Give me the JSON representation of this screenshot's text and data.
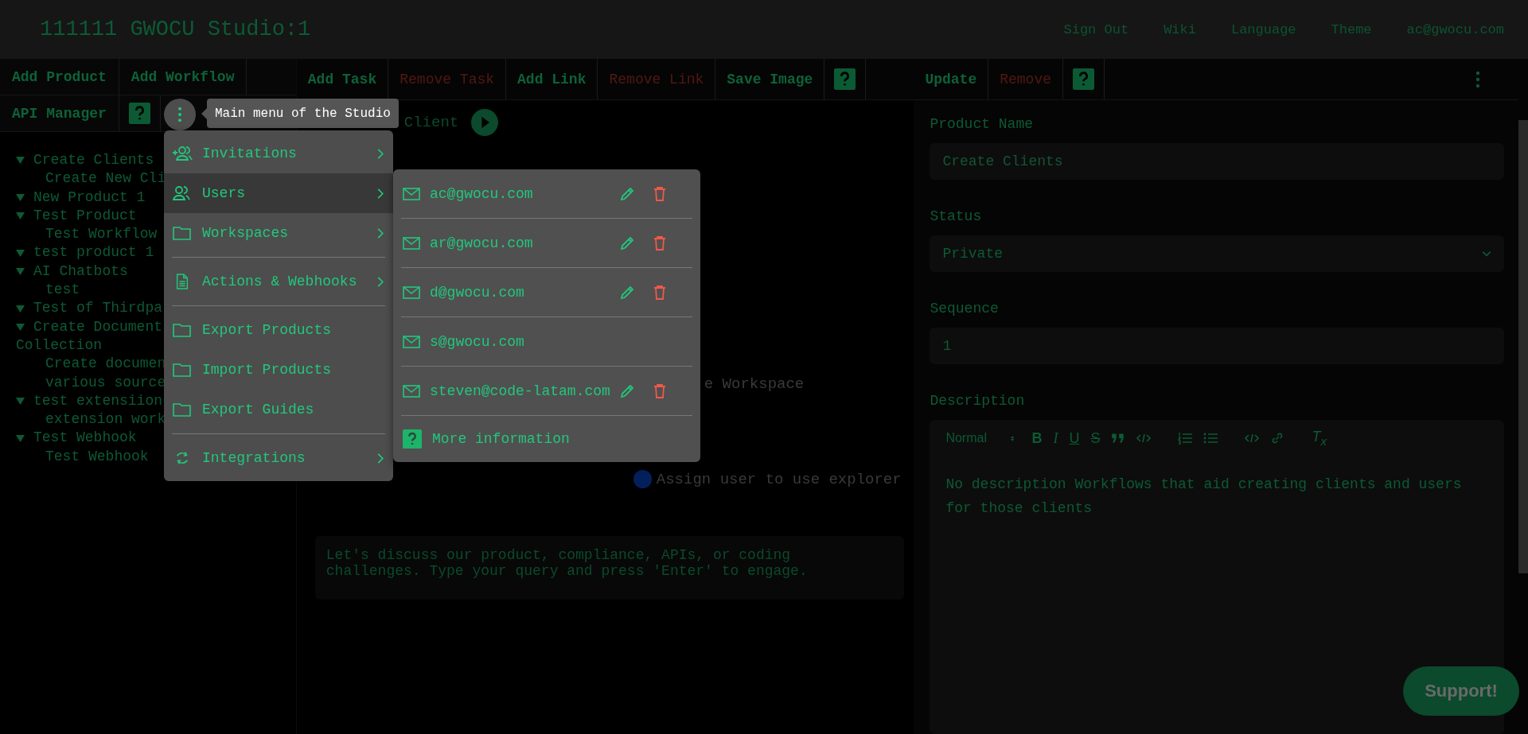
{
  "header": {
    "title": "111111 GWOCU Studio:1",
    "links": [
      "Sign Out",
      "Wiki",
      "Language",
      "Theme",
      "ac@gwocu.com"
    ]
  },
  "left_toolbar": {
    "rows": [
      [
        "Add Product",
        "Add Workflow"
      ],
      [
        "API Manager"
      ]
    ]
  },
  "tree": [
    {
      "label": "Create Clients",
      "children": [
        {
          "label": "Create New Cli"
        }
      ]
    },
    {
      "label": "New Product 1"
    },
    {
      "label": "Test Product",
      "children": [
        {
          "label": "Test Workflow"
        }
      ]
    },
    {
      "label": "test product 1"
    },
    {
      "label": "AI Chatbots",
      "children": [
        {
          "label": "test"
        }
      ]
    },
    {
      "label": "Test of Thirdpa"
    },
    {
      "label": "Create Document",
      "label_2": "Collection",
      "children": [
        {
          "label": "Create documen",
          "label_2": "various source"
        }
      ]
    },
    {
      "label": "test extensiion",
      "children": [
        {
          "label": "extension work"
        }
      ]
    },
    {
      "label": "Test Webhook",
      "children": [
        {
          "label": "Test Webhook"
        }
      ]
    }
  ],
  "middle_toolbar": [
    {
      "label": "Add Task",
      "kind": "normal"
    },
    {
      "label": "Remove Task",
      "kind": "danger"
    },
    {
      "label": "Add Link",
      "kind": "normal"
    },
    {
      "label": "Remove Link",
      "kind": "danger"
    },
    {
      "label": "Save Image",
      "kind": "normal"
    }
  ],
  "canvas": {
    "client_label": "Client",
    "workspace_label": "e Workspace",
    "assign_label": "Assign user to use explorer"
  },
  "chat": {
    "placeholder": "Let's discuss our product, compliance, APIs, or coding challenges. Type your query and press 'Enter' to engage."
  },
  "tooltip": "Main menu of the Studio",
  "main_menu": {
    "groups": [
      [
        {
          "label": "Invitations",
          "submenu": true,
          "selected": false
        },
        {
          "label": "Users",
          "submenu": true,
          "selected": true
        },
        {
          "label": "Workspaces",
          "submenu": true,
          "selected": false
        }
      ],
      [
        {
          "label": "Actions & Webhooks",
          "submenu": true,
          "selected": false
        }
      ],
      [
        {
          "label": "Export Products",
          "submenu": false,
          "selected": false
        },
        {
          "label": "Import Products",
          "submenu": false,
          "selected": false
        },
        {
          "label": "Export Guides",
          "submenu": false,
          "selected": false
        }
      ],
      [
        {
          "label": "Integrations",
          "submenu": true,
          "selected": false
        }
      ]
    ]
  },
  "users_menu": {
    "users": [
      {
        "email": "ac@gwocu.com",
        "actions": true
      },
      {
        "email": "ar@gwocu.com",
        "actions": true
      },
      {
        "email": "d@gwocu.com",
        "actions": true
      },
      {
        "email": "s@gwocu.com",
        "actions": false
      },
      {
        "email": "steven@code-latam.com",
        "actions": true
      }
    ],
    "more_info": "More information"
  },
  "right_toolbar": [
    {
      "label": "Update",
      "kind": "normal"
    },
    {
      "label": "Remove",
      "kind": "danger"
    }
  ],
  "form": {
    "product_name": {
      "label": "Product Name",
      "placeholder": "Create Clients"
    },
    "status": {
      "label": "Status",
      "value": "Private"
    },
    "sequence": {
      "label": "Sequence",
      "value": "1"
    },
    "description": {
      "label": "Description",
      "style": "Normal",
      "format_keys": [
        {
          "label": "B",
          "kind": "bold"
        },
        {
          "label": "I",
          "kind": "italic"
        },
        {
          "label": "U",
          "kind": "underline"
        },
        {
          "label": "S",
          "kind": "strike"
        }
      ],
      "clear": "T$_{x}$",
      "text": "No description Workflows that aid creating clients and users for those clients"
    }
  },
  "support": "Support!"
}
